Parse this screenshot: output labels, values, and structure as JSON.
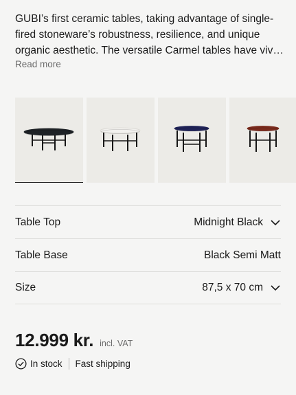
{
  "description": {
    "lines": [
      "GUBI’s first ceramic tables, taking advantage of single-",
      "fired stoneware’s robustness, resilience, and unique",
      "organic aesthetic. The versatile Carmel tables have viv…"
    ],
    "read_more": "Read more"
  },
  "thumbnails": [
    {
      "name": "midnight-black",
      "top_color": "#1e2226",
      "selected": true
    },
    {
      "name": "white",
      "top_color": "#f2f1ee",
      "selected": false
    },
    {
      "name": "blue",
      "top_color": "#1f2257",
      "selected": false
    },
    {
      "name": "red",
      "top_color": "#7a2a1c",
      "selected": false
    }
  ],
  "options": [
    {
      "label": "Table Top",
      "value": "Midnight Black",
      "has_dropdown": true
    },
    {
      "label": "Table Base",
      "value": "Black Semi Matt",
      "has_dropdown": false
    },
    {
      "label": "Size",
      "value": "87,5 x 70 cm",
      "has_dropdown": true
    }
  ],
  "price": {
    "amount": "12.999 kr.",
    "vat_note": "incl. VAT"
  },
  "availability": {
    "stock": "In stock",
    "shipping": "Fast shipping",
    "icon": "check-circle-icon"
  }
}
